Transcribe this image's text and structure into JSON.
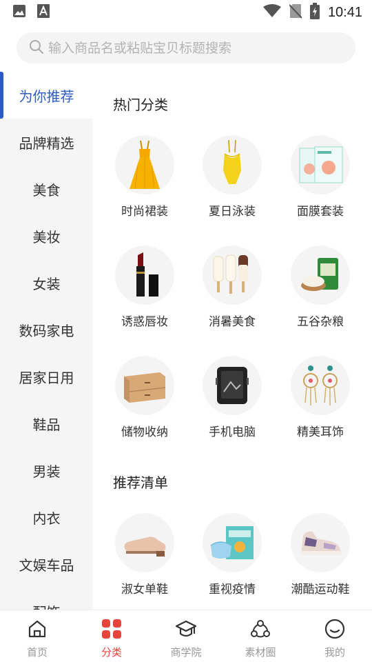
{
  "status_bar": {
    "time": "10:41",
    "left_icons": [
      "image-icon",
      "a-font-icon"
    ],
    "right_icons": [
      "wifi-icon",
      "no-sim-icon",
      "battery-charging-icon"
    ]
  },
  "search": {
    "placeholder": "输入商品名或粘贴宝贝标题搜索"
  },
  "sidebar": {
    "active_color": "#2d5bc4",
    "items": [
      {
        "label": "为你推荐",
        "active": true
      },
      {
        "label": "品牌精选"
      },
      {
        "label": "美食"
      },
      {
        "label": "美妆"
      },
      {
        "label": "女装"
      },
      {
        "label": "数码家电"
      },
      {
        "label": "居家日用"
      },
      {
        "label": "鞋品"
      },
      {
        "label": "男装"
      },
      {
        "label": "内衣"
      },
      {
        "label": "文娱车品"
      },
      {
        "label": "配饰"
      }
    ]
  },
  "hot_section": {
    "title": "热门分类",
    "items": [
      {
        "label": "时尚裙装",
        "icon": "yellow-dress-icon"
      },
      {
        "label": "夏日泳装",
        "icon": "yellow-swimsuit-icon"
      },
      {
        "label": "面膜套装",
        "icon": "face-mask-box-icon"
      },
      {
        "label": "诱惑唇妆",
        "icon": "lipstick-icon"
      },
      {
        "label": "消暑美食",
        "icon": "popsicle-icon"
      },
      {
        "label": "五谷杂粮",
        "icon": "rice-bag-icon"
      },
      {
        "label": "储物收纳",
        "icon": "storage-drawer-icon"
      },
      {
        "label": "手机电脑",
        "icon": "rugged-phone-icon"
      },
      {
        "label": "精美耳饰",
        "icon": "earrings-icon"
      }
    ]
  },
  "recommend_section": {
    "title": "推荐清单",
    "items": [
      {
        "label": "淑女单鞋",
        "icon": "loafer-shoe-icon"
      },
      {
        "label": "重视疫情",
        "icon": "face-masks-icon"
      },
      {
        "label": "潮酷运动鞋",
        "icon": "sneaker-icon"
      }
    ]
  },
  "bottom_nav": {
    "active_color": "#e8443c",
    "tabs": [
      {
        "label": "首页",
        "icon": "home-icon"
      },
      {
        "label": "分类",
        "icon": "category-grid-icon",
        "active": true
      },
      {
        "label": "商学院",
        "icon": "graduation-cap-icon"
      },
      {
        "label": "素材圈",
        "icon": "circle-share-icon"
      },
      {
        "label": "我的",
        "icon": "smiley-profile-icon"
      }
    ]
  }
}
